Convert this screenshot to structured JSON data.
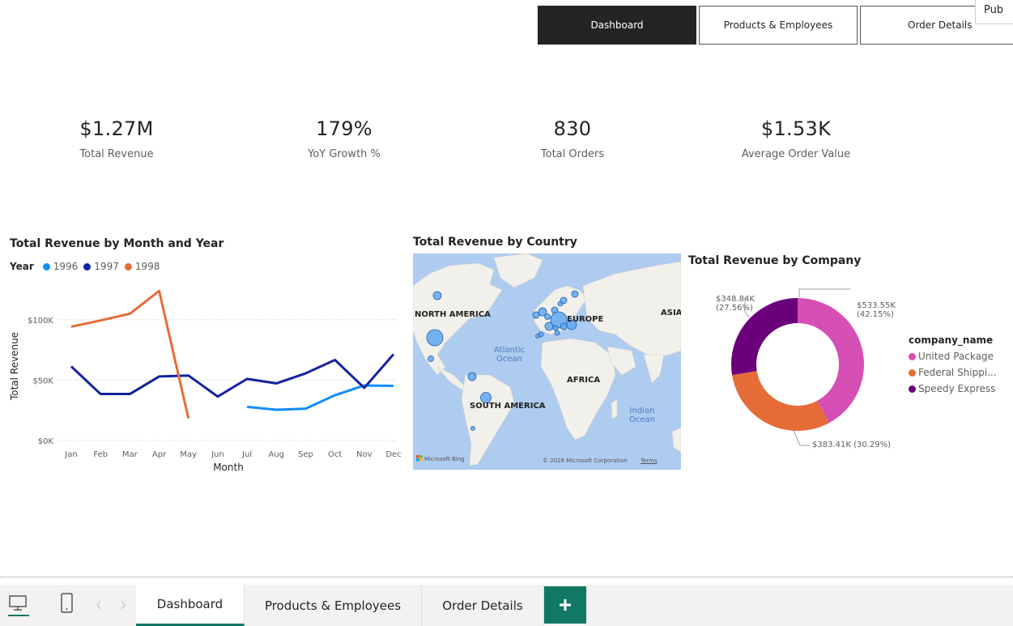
{
  "nav": {
    "buttons": [
      "Dashboard",
      "Products & Employees",
      "Order Details"
    ],
    "publish_fragment": "Pub"
  },
  "kpis": [
    {
      "value": "$1.27M",
      "label": "Total Revenue"
    },
    {
      "value": "179%",
      "label": "YoY Growth %"
    },
    {
      "value": "830",
      "label": "Total Orders"
    },
    {
      "value": "$1.53K",
      "label": "Average Order Value"
    }
  ],
  "line_chart": {
    "title": "Total Revenue by Month and Year",
    "legend_title": "Year",
    "legend_items": [
      "1996",
      "1997",
      "1998"
    ]
  },
  "map_chart": {
    "title": "Total Revenue by Country",
    "labels": {
      "north_america": "NORTH AMERICA",
      "europe": "EUROPE",
      "asia": "ASIA",
      "africa": "AFRICA",
      "south_america": "SOUTH AMERICA",
      "atlantic": "Atlantic Ocean",
      "indian": "Indian Ocean",
      "bing": "Microsoft Bing",
      "copyright": "© 2026 Microsoft Corporation",
      "terms": "Terms"
    },
    "bubble_color": "#5ea8f0"
  },
  "donut_chart": {
    "title": "Total Revenue by Company",
    "legend_title": "company_name",
    "legend_items": [
      "United Package",
      "Federal Shippi...",
      "Speedy Express"
    ],
    "labels": {
      "speedy_value": "$348.84K",
      "speedy_pct": "(27.56%)",
      "united_value": "$533.55K",
      "united_pct": "(42.15%)",
      "federal": "$383.41K (30.29%)"
    }
  },
  "chart_data": [
    {
      "type": "line",
      "title": "Total Revenue by Month and Year",
      "xlabel": "Month",
      "ylabel": "Total Revenue",
      "categories": [
        "Jan",
        "Feb",
        "Mar",
        "Apr",
        "May",
        "Jun",
        "Jul",
        "Aug",
        "Sep",
        "Oct",
        "Nov",
        "Dec"
      ],
      "ylim": [
        0,
        130000
      ],
      "yticks": [
        0,
        50000,
        100000
      ],
      "ytick_labels": [
        "$0K",
        "$50K",
        "$100K"
      ],
      "legend": "top-left",
      "series": [
        {
          "name": "1996",
          "color": "#118dff",
          "values": [
            null,
            null,
            null,
            null,
            null,
            null,
            27900,
            25500,
            26400,
            37500,
            45600,
            45200
          ]
        },
        {
          "name": "1997",
          "color": "#12239e",
          "values": [
            61300,
            38500,
            38500,
            53000,
            53800,
            36400,
            51000,
            47300,
            55600,
            66700,
            43600,
            71400
          ]
        },
        {
          "name": "1998",
          "color": "#e66c37",
          "values": [
            94200,
            99400,
            104900,
            123800,
            18300,
            null,
            null,
            null,
            null,
            null,
            null,
            null
          ]
        }
      ]
    },
    {
      "type": "pie",
      "title": "Total Revenue by Company",
      "legend": "right",
      "categories": [
        "United Package",
        "Federal Shipping",
        "Speedy Express"
      ],
      "values": [
        533550,
        383410,
        348840
      ],
      "percentages": [
        42.15,
        30.29,
        27.56
      ],
      "colors": [
        "#d64fb5",
        "#e66c37",
        "#6b007b"
      ]
    }
  ]
}
